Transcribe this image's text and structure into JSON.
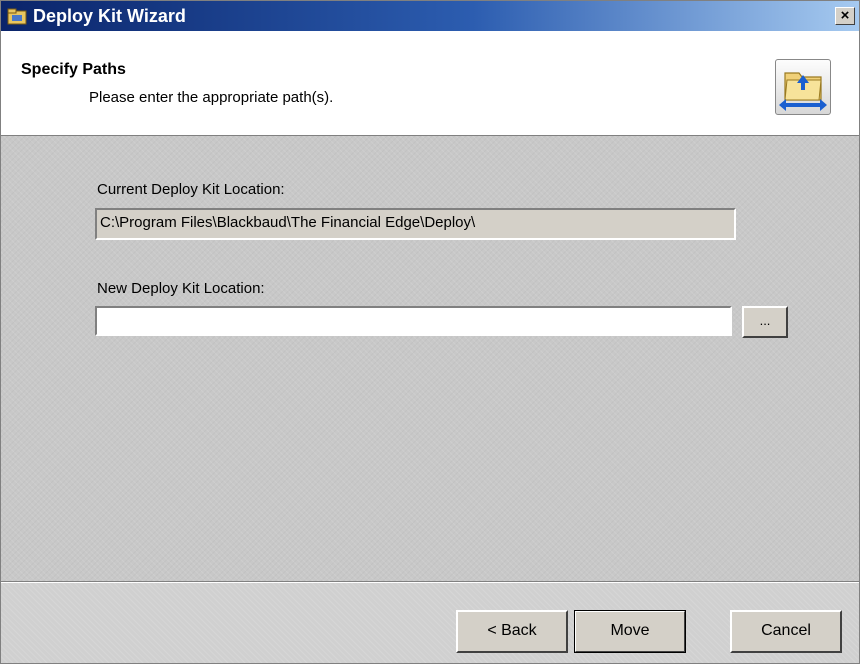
{
  "window": {
    "title": "Deploy Kit Wizard",
    "close_label": "×"
  },
  "header": {
    "title": "Specify Paths",
    "subtitle": "Please enter the appropriate path(s)."
  },
  "form": {
    "current_label": "Current Deploy Kit Location:",
    "current_value": "C:\\Program Files\\Blackbaud\\The Financial Edge\\Deploy\\",
    "new_label": "New Deploy Kit Location:",
    "new_value": "",
    "browse_label": "..."
  },
  "buttons": {
    "back": "< Back",
    "move": "Move",
    "cancel": "Cancel"
  },
  "icons": {
    "app": "deploy-kit-app-icon",
    "header": "folder-move-icon"
  },
  "colors": {
    "title_start": "#0a246a",
    "title_end": "#a6caf0",
    "face": "#d4d0c8",
    "accent": "#1a5fd0"
  }
}
